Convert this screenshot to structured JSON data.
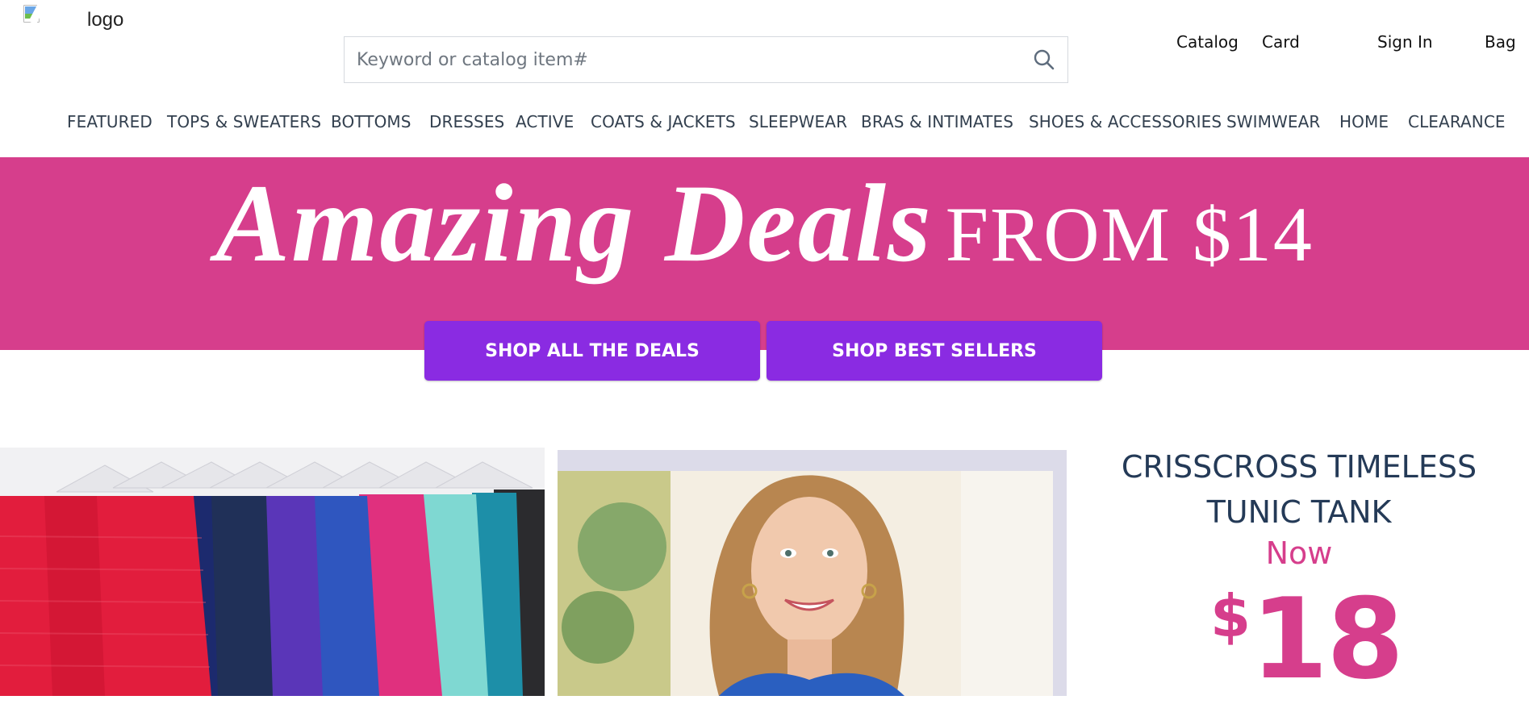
{
  "header": {
    "logo_alt": "logo",
    "search": {
      "placeholder": "Keyword or catalog item#",
      "value": ""
    },
    "links": {
      "catalog": "Catalog",
      "card": "Card",
      "sign_in": "Sign In",
      "bag": "Bag"
    }
  },
  "nav": {
    "items": [
      "FEATURED",
      "TOPS & SWEATERS",
      "BOTTOMS",
      "DRESSES",
      "ACTIVE",
      "COATS & JACKETS",
      "SLEEPWEAR",
      "BRAS & INTIMATES",
      "SHOES & ACCESSORIES",
      "SWIMWEAR",
      "HOME",
      "CLEARANCE"
    ]
  },
  "hero": {
    "headline_italic": "Amazing Deals",
    "headline_plain": "FROM $14",
    "background": "#d63e8c",
    "buttons": {
      "shop_deals": "SHOP ALL THE DEALS",
      "shop_best": "SHOP BEST SELLERS"
    },
    "button_color": "#8a2be2"
  },
  "promo": {
    "title_line1": "CRISSCROSS TIMELESS",
    "title_line2": "TUNIC TANK",
    "now": "Now",
    "currency": "$",
    "price": "18",
    "accent": "#d63e8c",
    "title_color": "#243a57"
  },
  "icons": {
    "search": "search-icon",
    "logo": "broken-image-icon"
  }
}
